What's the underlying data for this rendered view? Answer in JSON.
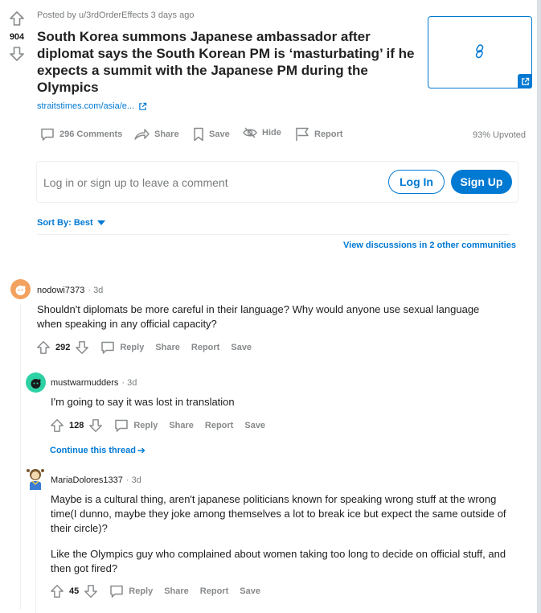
{
  "post": {
    "posted_by": "Posted by u/3rdOrderEffects 3 days ago",
    "votes": "904",
    "title": "South Korea summons Japanese ambassador after diplomat says the South Korean PM is ‘masturbating’ if he expects a summit with the Japanese PM during the Olympics",
    "link_text": "straitstimes.com/asia/e...",
    "actions": {
      "comments": "296 Comments",
      "share": "Share",
      "save": "Save",
      "hide": "Hide",
      "report": "Report"
    },
    "upvoted": "93% Upvoted"
  },
  "login": {
    "prompt": "Log in or sign up to leave a comment",
    "login_label": "Log In",
    "signup_label": "Sign Up"
  },
  "sort": {
    "label": "Sort By: Best"
  },
  "view_discussions": "View discussions in 2 other communities",
  "comments": [
    {
      "author": "nodowi7373",
      "time": "· 3d",
      "body": "Shouldn't diplomats be more careful in their language? Why would anyone use sexual language when speaking in any official capacity?",
      "score": "292",
      "reply": "Reply",
      "share": "Share",
      "report": "Report",
      "save": "Save",
      "avatar_color": "#f2a15e"
    },
    {
      "author": "mustwarmudders",
      "time": "· 3d",
      "body": "I'm going to say it was lost in translation",
      "score": "128",
      "reply": "Reply",
      "share": "Share",
      "report": "Report",
      "save": "Save",
      "avatar_color": "#2ed1a4",
      "continue": "Continue this thread"
    },
    {
      "author": "MariaDolores1337",
      "time": "· 3d",
      "body_p1": "Maybe is a cultural thing, aren't japanese politicians known for speaking wrong stuff at the wrong time(I dunno, maybe they joke among themselves a lot to break ice but expect the same outside of their circle)?",
      "body_p2": "Like the Olympics guy who complained about women taking too long to decide on official stuff, and then got fired?",
      "score": "45",
      "reply": "Reply",
      "share": "Share",
      "report": "Report",
      "save": "Save"
    }
  ],
  "colors": {
    "accent": "#0079d3",
    "background": "#dae0e6",
    "muted": "#878a8c"
  }
}
